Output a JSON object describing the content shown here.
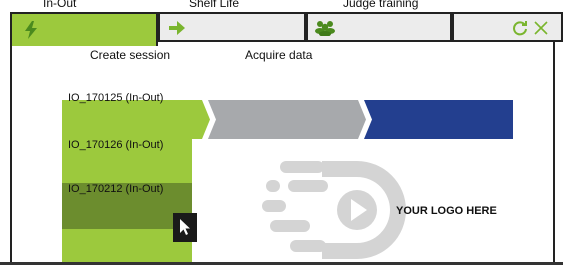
{
  "top_tabs": [
    {
      "label": "In-Out"
    },
    {
      "label": "Shelf Life"
    },
    {
      "label": "Judge training"
    }
  ],
  "icons": {
    "active_tab": "lightning-icon",
    "next": "arrow-right-icon",
    "group": "group-users-icon",
    "refresh": "refresh-icon",
    "close": "close-icon"
  },
  "subtabs": {
    "create": "Create session",
    "acquire": "Acquire data"
  },
  "sessions": [
    {
      "label": "IO_170125 (In-Out)"
    },
    {
      "label": "IO_170126 (In-Out)"
    },
    {
      "label": "IO_170212 (In-Out)"
    }
  ],
  "logo": {
    "text": "YOUR LOGO HERE"
  },
  "colors": {
    "green": "#9cc93d",
    "dark_green": "#6c8d2e",
    "gray_stage": "#a7a9ac",
    "blue_stage": "#233f8f",
    "logo_gray": "#d4d4d4"
  }
}
